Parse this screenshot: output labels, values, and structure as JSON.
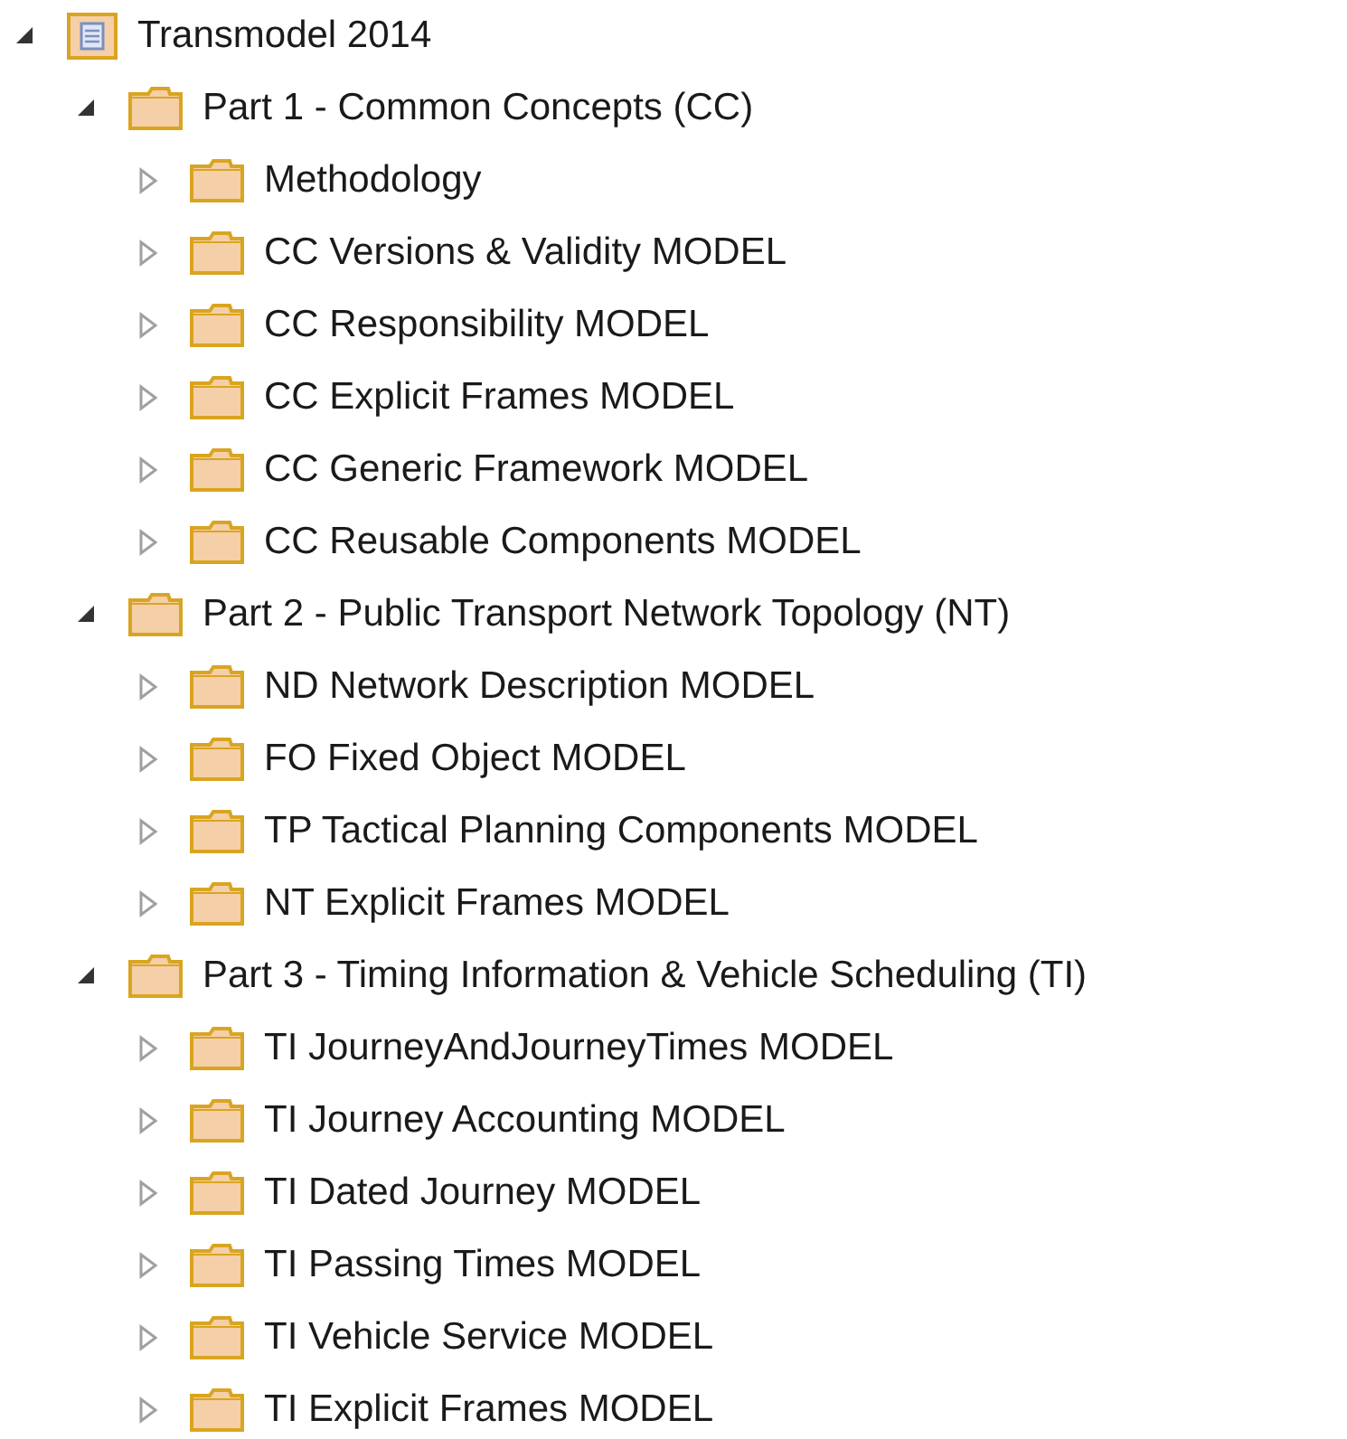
{
  "tree": [
    {
      "label": "Transmodel 2014",
      "kind": "model",
      "expanded": true,
      "children": [
        {
          "label": "Part 1 - Common Concepts (CC)",
          "kind": "folder",
          "expanded": true,
          "children": [
            {
              "label": "Methodology",
              "kind": "folder",
              "expanded": false
            },
            {
              "label": "CC Versions & Validity MODEL",
              "kind": "folder",
              "expanded": false
            },
            {
              "label": "CC Responsibility MODEL",
              "kind": "folder",
              "expanded": false
            },
            {
              "label": "CC Explicit Frames MODEL",
              "kind": "folder",
              "expanded": false
            },
            {
              "label": "CC Generic Framework MODEL",
              "kind": "folder",
              "expanded": false
            },
            {
              "label": "CC Reusable Components MODEL",
              "kind": "folder",
              "expanded": false
            }
          ]
        },
        {
          "label": "Part 2 - Public Transport Network Topology (NT)",
          "kind": "folder",
          "expanded": true,
          "children": [
            {
              "label": "ND Network Description MODEL",
              "kind": "folder",
              "expanded": false
            },
            {
              "label": "FO Fixed Object MODEL",
              "kind": "folder",
              "expanded": false
            },
            {
              "label": "TP Tactical Planning Components MODEL",
              "kind": "folder",
              "expanded": false
            },
            {
              "label": "NT Explicit Frames MODEL",
              "kind": "folder",
              "expanded": false
            }
          ]
        },
        {
          "label": "Part 3 - Timing Information & Vehicle Scheduling (TI)",
          "kind": "folder",
          "expanded": true,
          "children": [
            {
              "label": "TI JourneyAndJourneyTimes MODEL",
              "kind": "folder",
              "expanded": false
            },
            {
              "label": "TI Journey Accounting MODEL",
              "kind": "folder",
              "expanded": false
            },
            {
              "label": "TI Dated Journey MODEL",
              "kind": "folder",
              "expanded": false
            },
            {
              "label": "TI Passing Times MODEL",
              "kind": "folder",
              "expanded": false
            },
            {
              "label": "TI Vehicle Service MODEL",
              "kind": "folder",
              "expanded": false
            },
            {
              "label": "TI Explicit Frames MODEL",
              "kind": "folder",
              "expanded": false
            }
          ]
        }
      ]
    }
  ]
}
